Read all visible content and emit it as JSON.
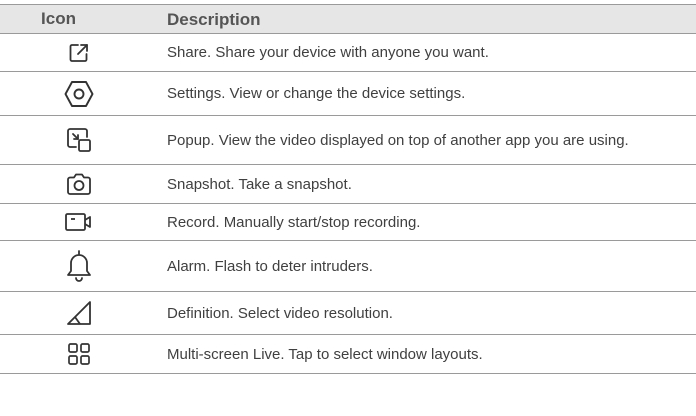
{
  "table": {
    "headers": {
      "icon": "Icon",
      "description": "Description"
    },
    "rows": [
      {
        "icon": "share-icon",
        "description": "Share. Share your device with anyone you want."
      },
      {
        "icon": "settings-icon",
        "description": "Settings. View or change the device settings."
      },
      {
        "icon": "popup-icon",
        "description": "Popup. View the video displayed on top of another app you are using."
      },
      {
        "icon": "camera-icon",
        "description": "Snapshot. Take a snapshot."
      },
      {
        "icon": "record-icon",
        "description": "Record. Manually start/stop recording."
      },
      {
        "icon": "bell-icon",
        "description": "Alarm. Flash to deter intruders."
      },
      {
        "icon": "signal-icon",
        "description": "Definition. Select video resolution."
      },
      {
        "icon": "grid-icon",
        "description": "Multi-screen Live. Tap to select window layouts."
      }
    ]
  }
}
